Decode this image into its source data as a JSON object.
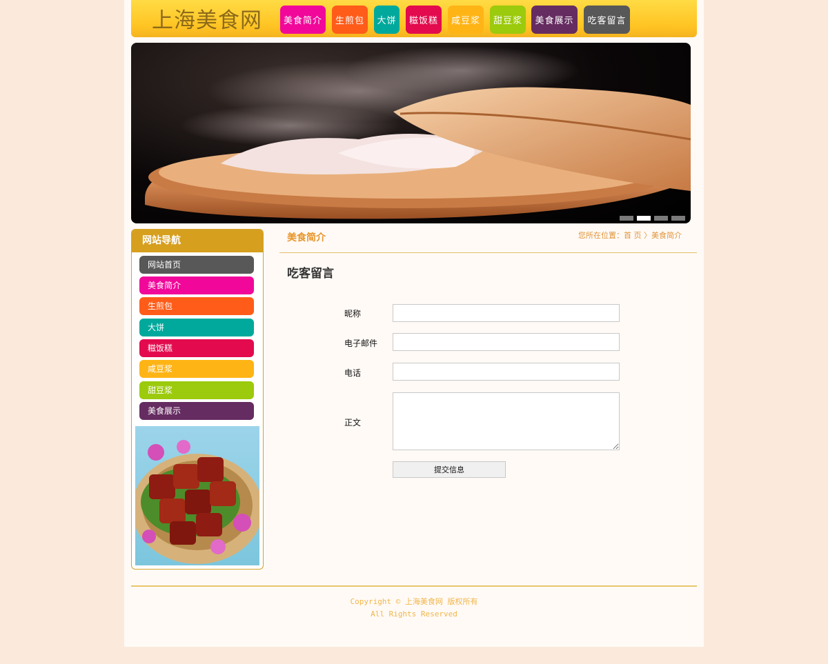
{
  "header": {
    "logo_text": "上海美食网",
    "nav": [
      {
        "label": "美食简介",
        "color": "#f1089a"
      },
      {
        "label": "生煎包",
        "color": "#ff5c1a"
      },
      {
        "label": "大饼",
        "color": "#00a99c"
      },
      {
        "label": "糍饭糕",
        "color": "#e30a4e"
      },
      {
        "label": "咸豆浆",
        "color": "#ffb416"
      },
      {
        "label": "甜豆浆",
        "color": "#9cca0c"
      },
      {
        "label": "美食展示",
        "color": "#652c61"
      },
      {
        "label": "吃客留言",
        "color": "#585858"
      }
    ]
  },
  "banner": {
    "slide_count": 4,
    "active_slide": 2
  },
  "sidebar": {
    "title": "网站导航",
    "items": [
      {
        "label": "网站首页",
        "color": "#585858"
      },
      {
        "label": "美食简介",
        "color": "#f1089a"
      },
      {
        "label": "生煎包",
        "color": "#ff5c1a"
      },
      {
        "label": "大饼",
        "color": "#00a99c"
      },
      {
        "label": "糍饭糕",
        "color": "#e30a4e"
      },
      {
        "label": "咸豆浆",
        "color": "#ffb416"
      },
      {
        "label": "甜豆浆",
        "color": "#9cca0c"
      },
      {
        "label": "美食展示",
        "color": "#652c61"
      }
    ]
  },
  "content": {
    "section_title": "美食简介",
    "breadcrumb": {
      "prefix": "您所在位置：",
      "home": "首 页",
      "separator": "〉",
      "current": "美食简介"
    },
    "form_title": "吃客留言",
    "fields": {
      "nickname_label": "昵称",
      "email_label": "电子邮件",
      "phone_label": "电话",
      "body_label": "正文",
      "nickname_value": "",
      "email_value": "",
      "phone_value": "",
      "body_value": ""
    },
    "submit_label": "提交信息"
  },
  "footer": {
    "line1": "Copyright © 上海美食网 版权所有",
    "line2": "All Rights Reserved"
  },
  "colors": {
    "accent": "#d69f1e",
    "header_yellow": "#ffc423",
    "page_bg": "#fbeadc",
    "breadcrumb": "#e0953a"
  }
}
